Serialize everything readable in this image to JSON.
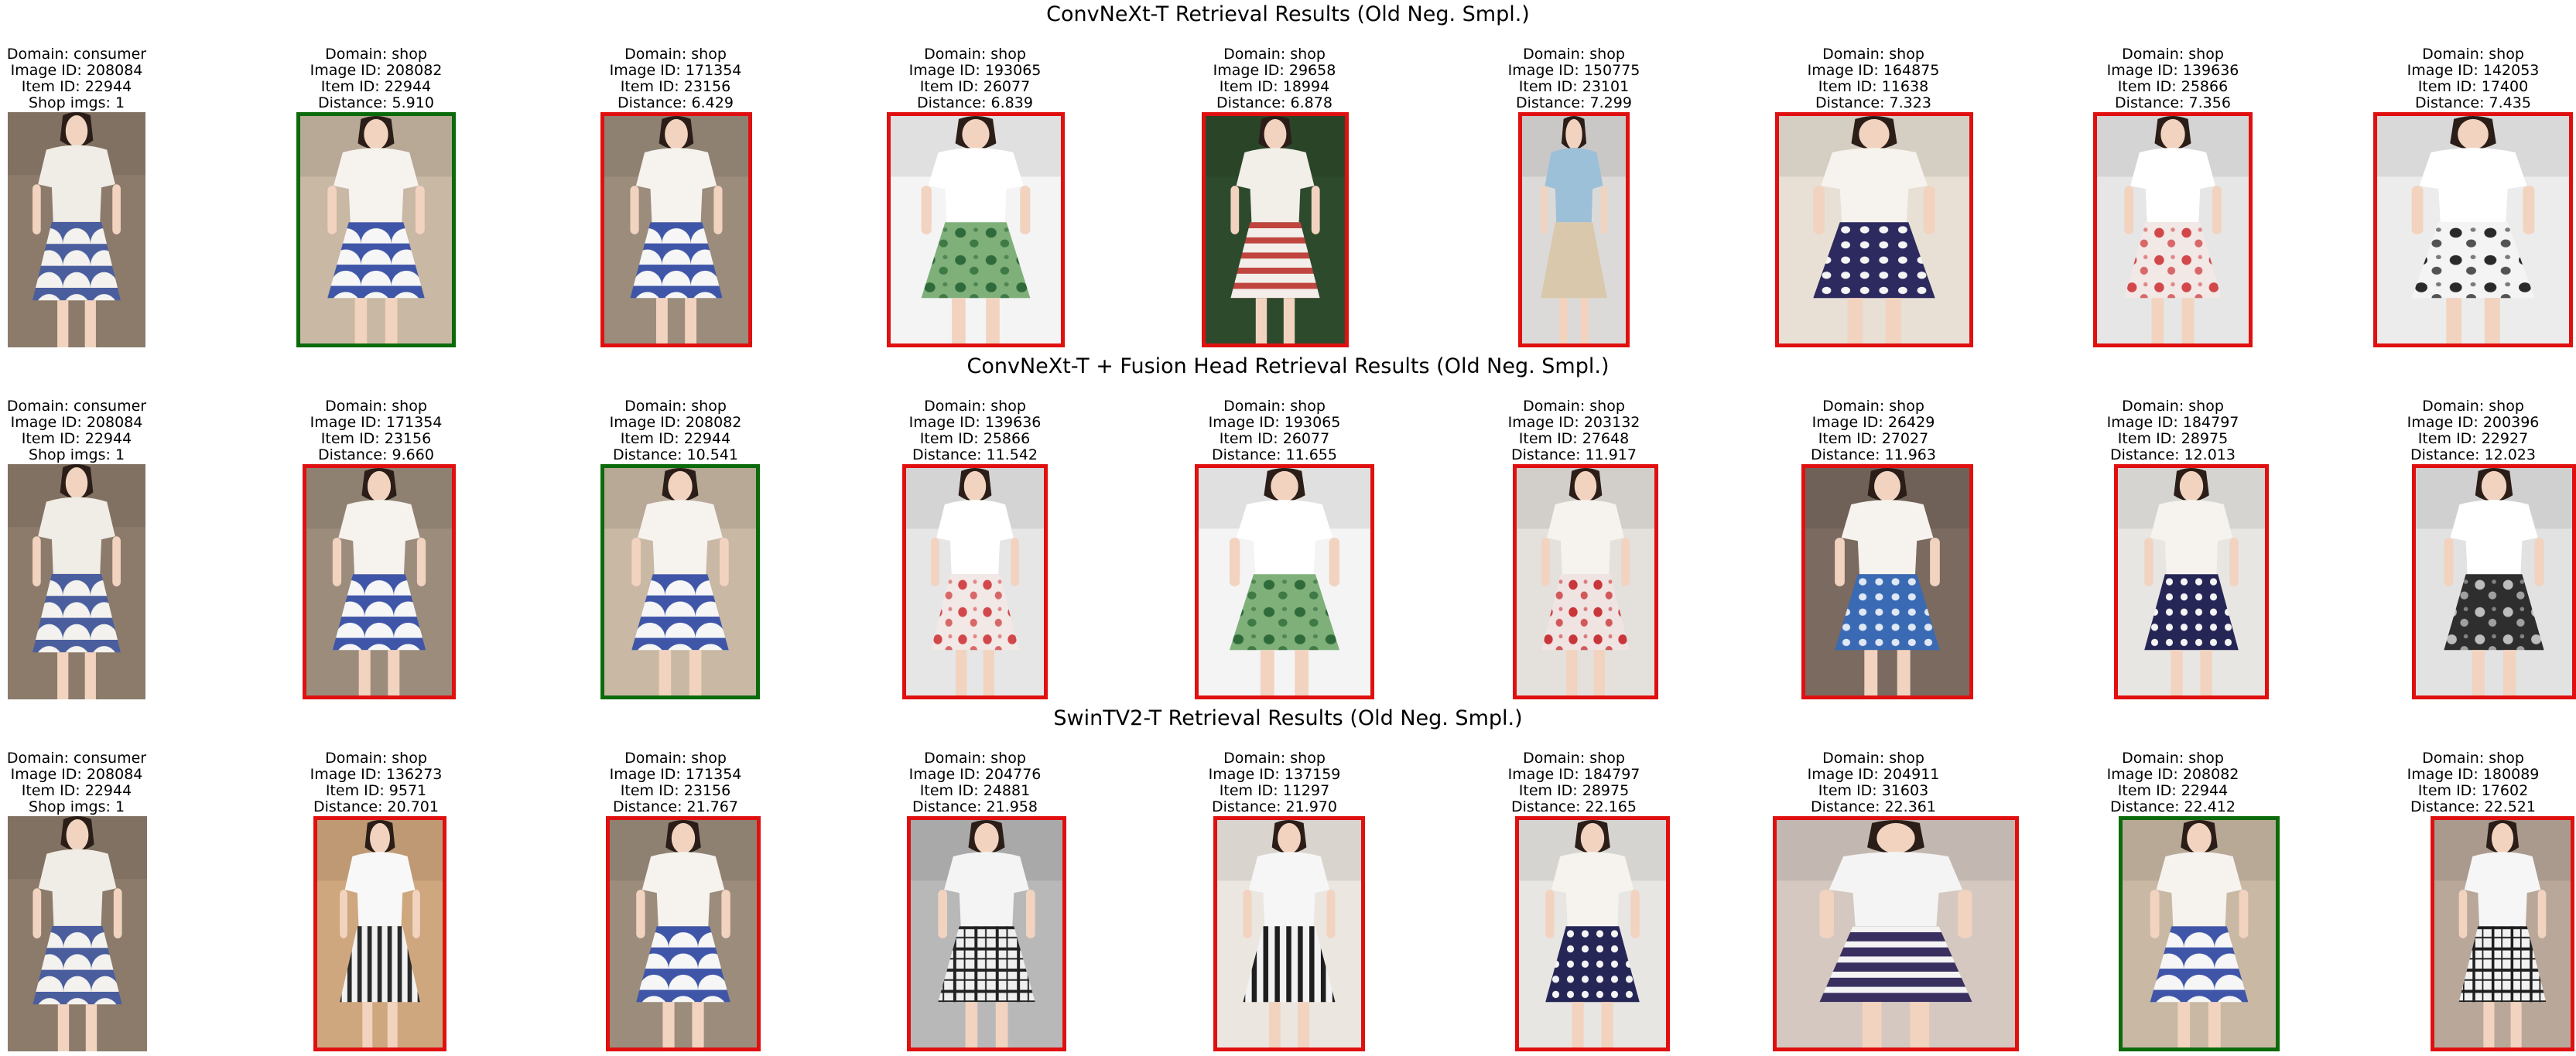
{
  "rows": [
    {
      "title": "ConvNeXt-T Retrieval Results (Old Neg. Smpl.)",
      "items": [
        {
          "lines": [
            "Domain: consumer",
            "Image ID: 208084",
            "Item ID: 22944",
            "Shop imgs: 1"
          ],
          "status": "query",
          "bg": "#8c7b6b",
          "top": "#f0ece6",
          "bottom": "#4a5e9e",
          "pattern": "scallop",
          "pattern_color": "#f4f2ee"
        },
        {
          "lines": [
            "Domain: shop",
            "Image ID: 208082",
            "Item ID: 22944",
            "Distance: 5.910"
          ],
          "status": "match",
          "bg": "#c8b8a4",
          "top": "#f6f2ee",
          "bottom": "#3f56a8",
          "pattern": "scallop",
          "pattern_color": "#f6f6f6"
        },
        {
          "lines": [
            "Domain: shop",
            "Image ID: 171354",
            "Item ID: 23156",
            "Distance: 6.429"
          ],
          "status": "nomatch",
          "bg": "#9c8c7c",
          "top": "#f6f2ee",
          "bottom": "#3f56a8",
          "pattern": "scallop",
          "pattern_color": "#f6f6f6"
        },
        {
          "lines": [
            "Domain: shop",
            "Image ID: 193065",
            "Item ID: 26077",
            "Distance: 6.839"
          ],
          "status": "nomatch",
          "bg": "#f4f4f4",
          "top": "#ffffff",
          "bottom": "#7fb07a",
          "pattern": "floral",
          "pattern_color": "#2f6b3a"
        },
        {
          "lines": [
            "Domain: shop",
            "Image ID: 29658",
            "Item ID: 18994",
            "Distance: 6.878"
          ],
          "status": "nomatch",
          "bg": "#2e4a2c",
          "top": "#f2efe9",
          "bottom": "#f3eeea",
          "pattern": "stripes",
          "pattern_color": "#c0453f"
        },
        {
          "lines": [
            "Domain: shop",
            "Image ID: 150775",
            "Item ID: 23101",
            "Distance: 7.299"
          ],
          "status": "nomatch",
          "bg": "#dcdad8",
          "top": "#9cc0d8",
          "bottom": "#d9c8ac",
          "pattern": "plain",
          "pattern_color": "#d9c8ac"
        },
        {
          "lines": [
            "Domain: shop",
            "Image ID: 164875",
            "Item ID: 11638",
            "Distance: 7.323"
          ],
          "status": "nomatch",
          "bg": "#e8e0d4",
          "top": "#f6f3ee",
          "bottom": "#2c2a5e",
          "pattern": "dots",
          "pattern_color": "#f4f4f4"
        },
        {
          "lines": [
            "Domain: shop",
            "Image ID: 139636",
            "Item ID: 25866",
            "Distance: 7.356"
          ],
          "status": "nomatch",
          "bg": "#e6e6e6",
          "top": "#ffffff",
          "bottom": "#f2e8e6",
          "pattern": "floral",
          "pattern_color": "#d2474a"
        },
        {
          "lines": [
            "Domain: shop",
            "Image ID: 142053",
            "Item ID: 17400",
            "Distance: 7.435"
          ],
          "status": "nomatch",
          "bg": "#ececec",
          "top": "#ffffff",
          "bottom": "#f4f4f4",
          "pattern": "floral",
          "pattern_color": "#2a2a2a"
        }
      ]
    },
    {
      "title": "ConvNeXt-T + Fusion Head Retrieval Results (Old Neg. Smpl.)",
      "items": [
        {
          "lines": [
            "Domain: consumer",
            "Image ID: 208084",
            "Item ID: 22944",
            "Shop imgs: 1"
          ],
          "status": "query",
          "bg": "#8c7b6b",
          "top": "#f0ece6",
          "bottom": "#4a5e9e",
          "pattern": "scallop",
          "pattern_color": "#f4f2ee"
        },
        {
          "lines": [
            "Domain: shop",
            "Image ID: 171354",
            "Item ID: 23156",
            "Distance: 9.660"
          ],
          "status": "nomatch",
          "bg": "#9c8c7c",
          "top": "#f6f2ee",
          "bottom": "#3f56a8",
          "pattern": "scallop",
          "pattern_color": "#f6f6f6"
        },
        {
          "lines": [
            "Domain: shop",
            "Image ID: 208082",
            "Item ID: 22944",
            "Distance: 10.541"
          ],
          "status": "match",
          "bg": "#c8b8a4",
          "top": "#f6f2ee",
          "bottom": "#3f56a8",
          "pattern": "scallop",
          "pattern_color": "#f6f6f6"
        },
        {
          "lines": [
            "Domain: shop",
            "Image ID: 139636",
            "Item ID: 25866",
            "Distance: 11.542"
          ],
          "status": "nomatch",
          "bg": "#e6e6e6",
          "top": "#ffffff",
          "bottom": "#f2e8e6",
          "pattern": "floral",
          "pattern_color": "#d2474a"
        },
        {
          "lines": [
            "Domain: shop",
            "Image ID: 193065",
            "Item ID: 26077",
            "Distance: 11.655"
          ],
          "status": "nomatch",
          "bg": "#f4f4f4",
          "top": "#ffffff",
          "bottom": "#7fb07a",
          "pattern": "floral",
          "pattern_color": "#2f6b3a"
        },
        {
          "lines": [
            "Domain: shop",
            "Image ID: 203132",
            "Item ID: 27648",
            "Distance: 11.917"
          ],
          "status": "nomatch",
          "bg": "#e4e0dc",
          "top": "#f6f3ee",
          "bottom": "#f0e4e2",
          "pattern": "floral",
          "pattern_color": "#c9363a"
        },
        {
          "lines": [
            "Domain: shop",
            "Image ID: 26429",
            "Item ID: 27027",
            "Distance: 11.963"
          ],
          "status": "nomatch",
          "bg": "#7a6a60",
          "top": "#f6f3ee",
          "bottom": "#3b6ab4",
          "pattern": "dots",
          "pattern_color": "#dfe8f4"
        },
        {
          "lines": [
            "Domain: shop",
            "Image ID: 184797",
            "Item ID: 28975",
            "Distance: 12.013"
          ],
          "status": "nomatch",
          "bg": "#e8e6e2",
          "top": "#f6f3ee",
          "bottom": "#262656",
          "pattern": "dots",
          "pattern_color": "#f4f4f4"
        },
        {
          "lines": [
            "Domain: shop",
            "Image ID: 200396",
            "Item ID: 22927",
            "Distance: 12.023"
          ],
          "status": "nomatch",
          "bg": "#e2e2e2",
          "top": "#ffffff",
          "bottom": "#2e2e2e",
          "pattern": "floral",
          "pattern_color": "#bdbdbd"
        }
      ]
    },
    {
      "title": "SwinTV2-T Retrieval Results (Old Neg. Smpl.)",
      "items": [
        {
          "lines": [
            "Domain: consumer",
            "Image ID: 208084",
            "Item ID: 22944",
            "Shop imgs: 1"
          ],
          "status": "query",
          "bg": "#8c7b6b",
          "top": "#f0ece6",
          "bottom": "#4a5e9e",
          "pattern": "scallop",
          "pattern_color": "#f4f2ee"
        },
        {
          "lines": [
            "Domain: shop",
            "Image ID: 136273",
            "Item ID: 9571",
            "Distance: 20.701"
          ],
          "status": "nomatch",
          "bg": "#cfa77e",
          "top": "#f8f8f8",
          "bottom": "#f2f2f2",
          "pattern": "vstripes",
          "pattern_color": "#2a2a2a"
        },
        {
          "lines": [
            "Domain: shop",
            "Image ID: 171354",
            "Item ID: 23156",
            "Distance: 21.767"
          ],
          "status": "nomatch",
          "bg": "#9c8c7c",
          "top": "#f6f2ee",
          "bottom": "#3f56a8",
          "pattern": "scallop",
          "pattern_color": "#f6f6f6"
        },
        {
          "lines": [
            "Domain: shop",
            "Image ID: 204776",
            "Item ID: 24881",
            "Distance: 21.958"
          ],
          "status": "nomatch",
          "bg": "#b8b8b8",
          "top": "#f4f4f4",
          "bottom": "#efefef",
          "pattern": "plaid",
          "pattern_color": "#222222"
        },
        {
          "lines": [
            "Domain: shop",
            "Image ID: 137159",
            "Item ID: 11297",
            "Distance: 21.970"
          ],
          "status": "nomatch",
          "bg": "#ece6e0",
          "top": "#f6f6f6",
          "bottom": "#f2f2f2",
          "pattern": "vstripes",
          "pattern_color": "#1e1e1e"
        },
        {
          "lines": [
            "Domain: shop",
            "Image ID: 184797",
            "Item ID: 28975",
            "Distance: 22.165"
          ],
          "status": "nomatch",
          "bg": "#e8e6e2",
          "top": "#f6f3ee",
          "bottom": "#262656",
          "pattern": "dots",
          "pattern_color": "#f4f4f4"
        },
        {
          "lines": [
            "Domain: shop",
            "Image ID: 204911",
            "Item ID: 31603",
            "Distance: 22.361"
          ],
          "status": "nomatch",
          "bg": "#d4c8c0",
          "top": "#f4f4f4",
          "bottom": "#3a3060",
          "pattern": "stripes",
          "pattern_color": "#f4f4f4"
        },
        {
          "lines": [
            "Domain: shop",
            "Image ID: 208082",
            "Item ID: 22944",
            "Distance: 22.412"
          ],
          "status": "match",
          "bg": "#c8b8a4",
          "top": "#f6f2ee",
          "bottom": "#3f56a8",
          "pattern": "scallop",
          "pattern_color": "#f6f6f6"
        },
        {
          "lines": [
            "Domain: shop",
            "Image ID: 180089",
            "Item ID: 17602",
            "Distance: 22.521"
          ],
          "status": "nomatch",
          "bg": "#b9a89a",
          "top": "#f6f6f6",
          "bottom": "#f2f2f2",
          "pattern": "plaid",
          "pattern_color": "#1e1e1e"
        }
      ]
    }
  ]
}
